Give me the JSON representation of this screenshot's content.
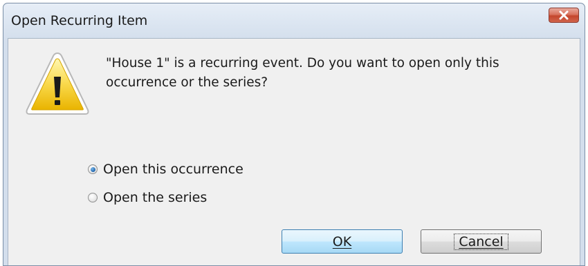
{
  "window": {
    "title": "Open Recurring Item"
  },
  "dialog": {
    "message": "\"House 1\" is a recurring event. Do you want to open only this occurrence or the series?",
    "options": [
      {
        "label": "Open this occurrence",
        "selected": true
      },
      {
        "label": "Open the series",
        "selected": false
      }
    ],
    "buttons": {
      "ok_label": "OK",
      "cancel_label": "Cancel"
    }
  },
  "icons": {
    "close": "close-icon",
    "warning": "warning-icon"
  },
  "colors": {
    "close_button": "#c4462d",
    "warning_yellow": "#f5c400",
    "dialog_background": "#f0f0f0"
  }
}
